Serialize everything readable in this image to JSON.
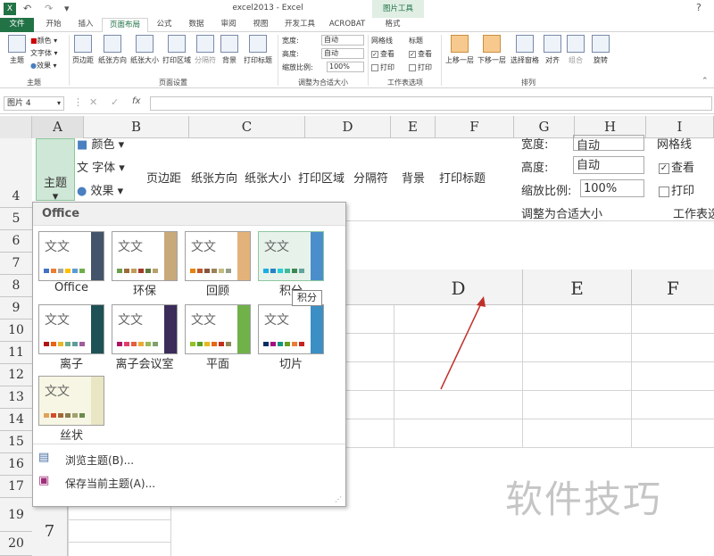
{
  "window": {
    "title": "excel2013 - Excel",
    "context_tab": "图片工具"
  },
  "tabs": [
    "文件",
    "开始",
    "插入",
    "页面布局",
    "公式",
    "数据",
    "审阅",
    "视图",
    "开发工具",
    "ACROBAT",
    "格式"
  ],
  "ribbon": {
    "theme_group": {
      "label": "主题",
      "big": "主题",
      "colors": "颜色",
      "fonts": "字体",
      "effects": "效果"
    },
    "page_setup": {
      "label": "页面设置",
      "items": [
        "页边距",
        "纸张方向",
        "纸张大小",
        "打印区域",
        "分隔符",
        "背景",
        "打印标题"
      ]
    },
    "scale": {
      "label": "调整为合适大小",
      "width_label": "宽度:",
      "width_val": "自动",
      "height_label": "高度:",
      "height_val": "自动",
      "scale_label": "缩放比例:",
      "scale_val": "100%"
    },
    "sheet_opts": {
      "label": "工作表选项",
      "gridlines": "网格线",
      "headings": "标题",
      "view": "查看",
      "print": "打印"
    },
    "arrange": {
      "label": "排列",
      "items": [
        "上移一层",
        "下移一层",
        "选择窗格",
        "对齐",
        "组合",
        "旋转"
      ]
    }
  },
  "formula": {
    "name_box": "图片 4",
    "fx": "fx"
  },
  "columns": [
    "A",
    "B",
    "C",
    "D",
    "E",
    "F",
    "G",
    "H",
    "I"
  ],
  "rows": [
    "4",
    "5",
    "6",
    "7",
    "8",
    "9",
    "10",
    "11",
    "12",
    "13",
    "14",
    "15",
    "16",
    "17",
    "19",
    "20"
  ],
  "zoomed": {
    "cols": [
      "D",
      "E",
      "F"
    ],
    "row_label": "7",
    "theme": "主题",
    "colors": "颜色",
    "fonts": "字体",
    "effects": "效果",
    "items": [
      "页边距",
      "纸张方向",
      "纸张大小",
      "打印区域",
      "分隔符",
      "背景",
      "打印标题"
    ],
    "width_label": "宽度:",
    "width_val": "自动",
    "height_label": "高度:",
    "height_val": "自动",
    "scale_label": "缩放比例:",
    "scale_val": "100%",
    "scale_group": "调整为合适大小",
    "gridlines": "网格线",
    "view": "查看",
    "print": "打印",
    "sheet_group": "工作表选"
  },
  "themes_menu": {
    "header": "Office",
    "themes": [
      "Office",
      "环保",
      "回顾",
      "积分",
      "离子",
      "离子会议室",
      "平面",
      "切片",
      "丝状"
    ],
    "tooltip": "积分",
    "browse": "浏览主题(B)...",
    "save": "保存当前主题(A)...",
    "thumb_text": "文文"
  },
  "watermark": "软件技巧"
}
